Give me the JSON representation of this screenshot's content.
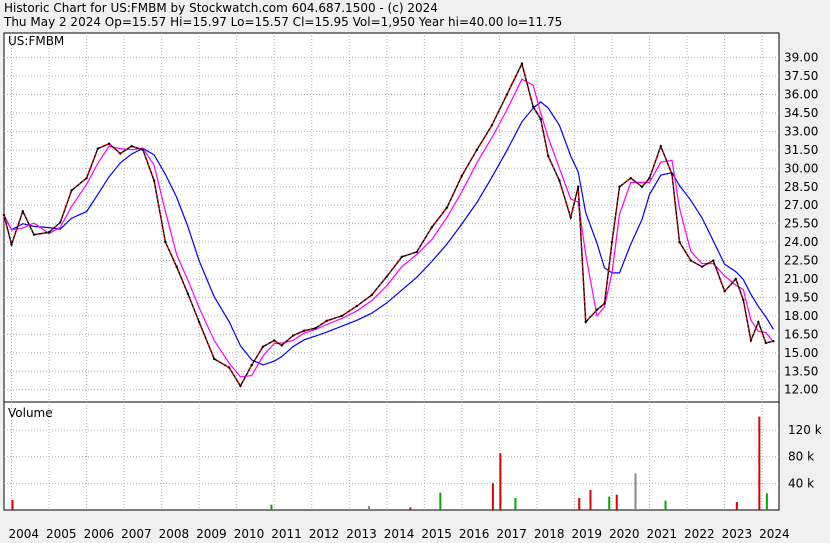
{
  "header": {
    "line1": "Historic Chart for US:FMBM by Stockwatch.com 604.687.1500 - (c) 2024",
    "line2": "Thu May  2 2024   Op=15.57   Hi=15.97   Lo=15.57   Cl=15.95   Vol=1,950   Year hi=40.00   lo=11.75"
  },
  "chart_data": [
    {
      "type": "line",
      "title": "US:FMBM",
      "ylim": [
        11,
        41
      ],
      "y_ticks": [
        "12.00",
        "13.50",
        "15.00",
        "16.50",
        "18.00",
        "19.50",
        "21.00",
        "22.50",
        "24.00",
        "25.50",
        "27.00",
        "28.50",
        "30.00",
        "31.50",
        "33.00",
        "34.50",
        "36.00",
        "37.50",
        "39.00"
      ],
      "x_ticks": [
        "2004",
        "2005",
        "2006",
        "2007",
        "2008",
        "2009",
        "2010",
        "2011",
        "2012",
        "2013",
        "2014",
        "2015",
        "2016",
        "2017",
        "2018",
        "2019",
        "2020",
        "2021",
        "2022",
        "2023",
        "2024"
      ],
      "grid": true,
      "colors": {
        "price": "#000000",
        "short_ma": "#ff0000",
        "mid_ma": "#ff00ff",
        "long_ma": "#0000ff"
      },
      "series": [
        {
          "x": [
            2003.8,
            2004.0,
            2004.3,
            2004.6,
            2005.0,
            2005.3,
            2005.6,
            2006.0,
            2006.3,
            2006.6,
            2006.9,
            2007.2,
            2007.5,
            2007.8,
            2008.1,
            2008.4,
            2008.7,
            2009.0,
            2009.4,
            2009.8,
            2010.1,
            2010.4,
            2010.7,
            2011.0,
            2011.2,
            2011.5,
            2011.8,
            2012.1,
            2012.4,
            2012.8,
            2013.2,
            2013.6,
            2014.0,
            2014.4,
            2014.8,
            2015.2,
            2015.6,
            2016.0,
            2016.4,
            2016.8,
            2017.2,
            2017.6,
            2017.9,
            2018.1,
            2018.3,
            2018.6,
            2018.9,
            2019.1,
            2019.3,
            2019.6,
            2019.8,
            2020.0,
            2020.2,
            2020.5,
            2020.8,
            2021.0,
            2021.3,
            2021.6,
            2021.8,
            2022.1,
            2022.4,
            2022.7,
            2023.0,
            2023.3,
            2023.5,
            2023.7,
            2023.9,
            2024.1,
            2024.3
          ],
          "values": [
            26.2,
            23.8,
            26.5,
            24.6,
            24.8,
            25.6,
            28.2,
            29.2,
            31.6,
            32.0,
            31.2,
            31.8,
            31.5,
            29.0,
            24.0,
            22.0,
            19.8,
            17.5,
            14.5,
            13.8,
            12.3,
            14.0,
            15.5,
            16.0,
            15.6,
            16.4,
            16.8,
            17.0,
            17.6,
            18.0,
            18.8,
            19.7,
            21.2,
            22.8,
            23.2,
            25.2,
            26.8,
            29.4,
            31.5,
            33.5,
            36.0,
            38.5,
            35.0,
            34.0,
            31.0,
            29.0,
            26.0,
            28.5,
            17.5,
            18.5,
            19.0,
            24.0,
            28.5,
            29.2,
            28.5,
            29.2,
            31.8,
            29.5,
            24.0,
            22.5,
            22.0,
            22.5,
            20.0,
            21.0,
            19.3,
            16.0,
            17.5,
            15.8,
            15.95
          ]
        }
      ]
    },
    {
      "type": "bar",
      "title": "Volume",
      "ylim": [
        0,
        150000
      ],
      "y_ticks": [
        "40 k",
        "80 k",
        "120 k"
      ],
      "x": [
        2004.0,
        2010.9,
        2013.5,
        2014.6,
        2015.4,
        2016.8,
        2017.0,
        2017.4,
        2019.1,
        2019.4,
        2019.9,
        2020.1,
        2020.6,
        2021.4,
        2023.3,
        2023.9,
        2024.1
      ],
      "values": [
        15000,
        8000,
        6000,
        4000,
        26000,
        40000,
        85000,
        18000,
        18000,
        30000,
        20000,
        23000,
        55000,
        14000,
        12000,
        140000,
        25000
      ]
    }
  ]
}
